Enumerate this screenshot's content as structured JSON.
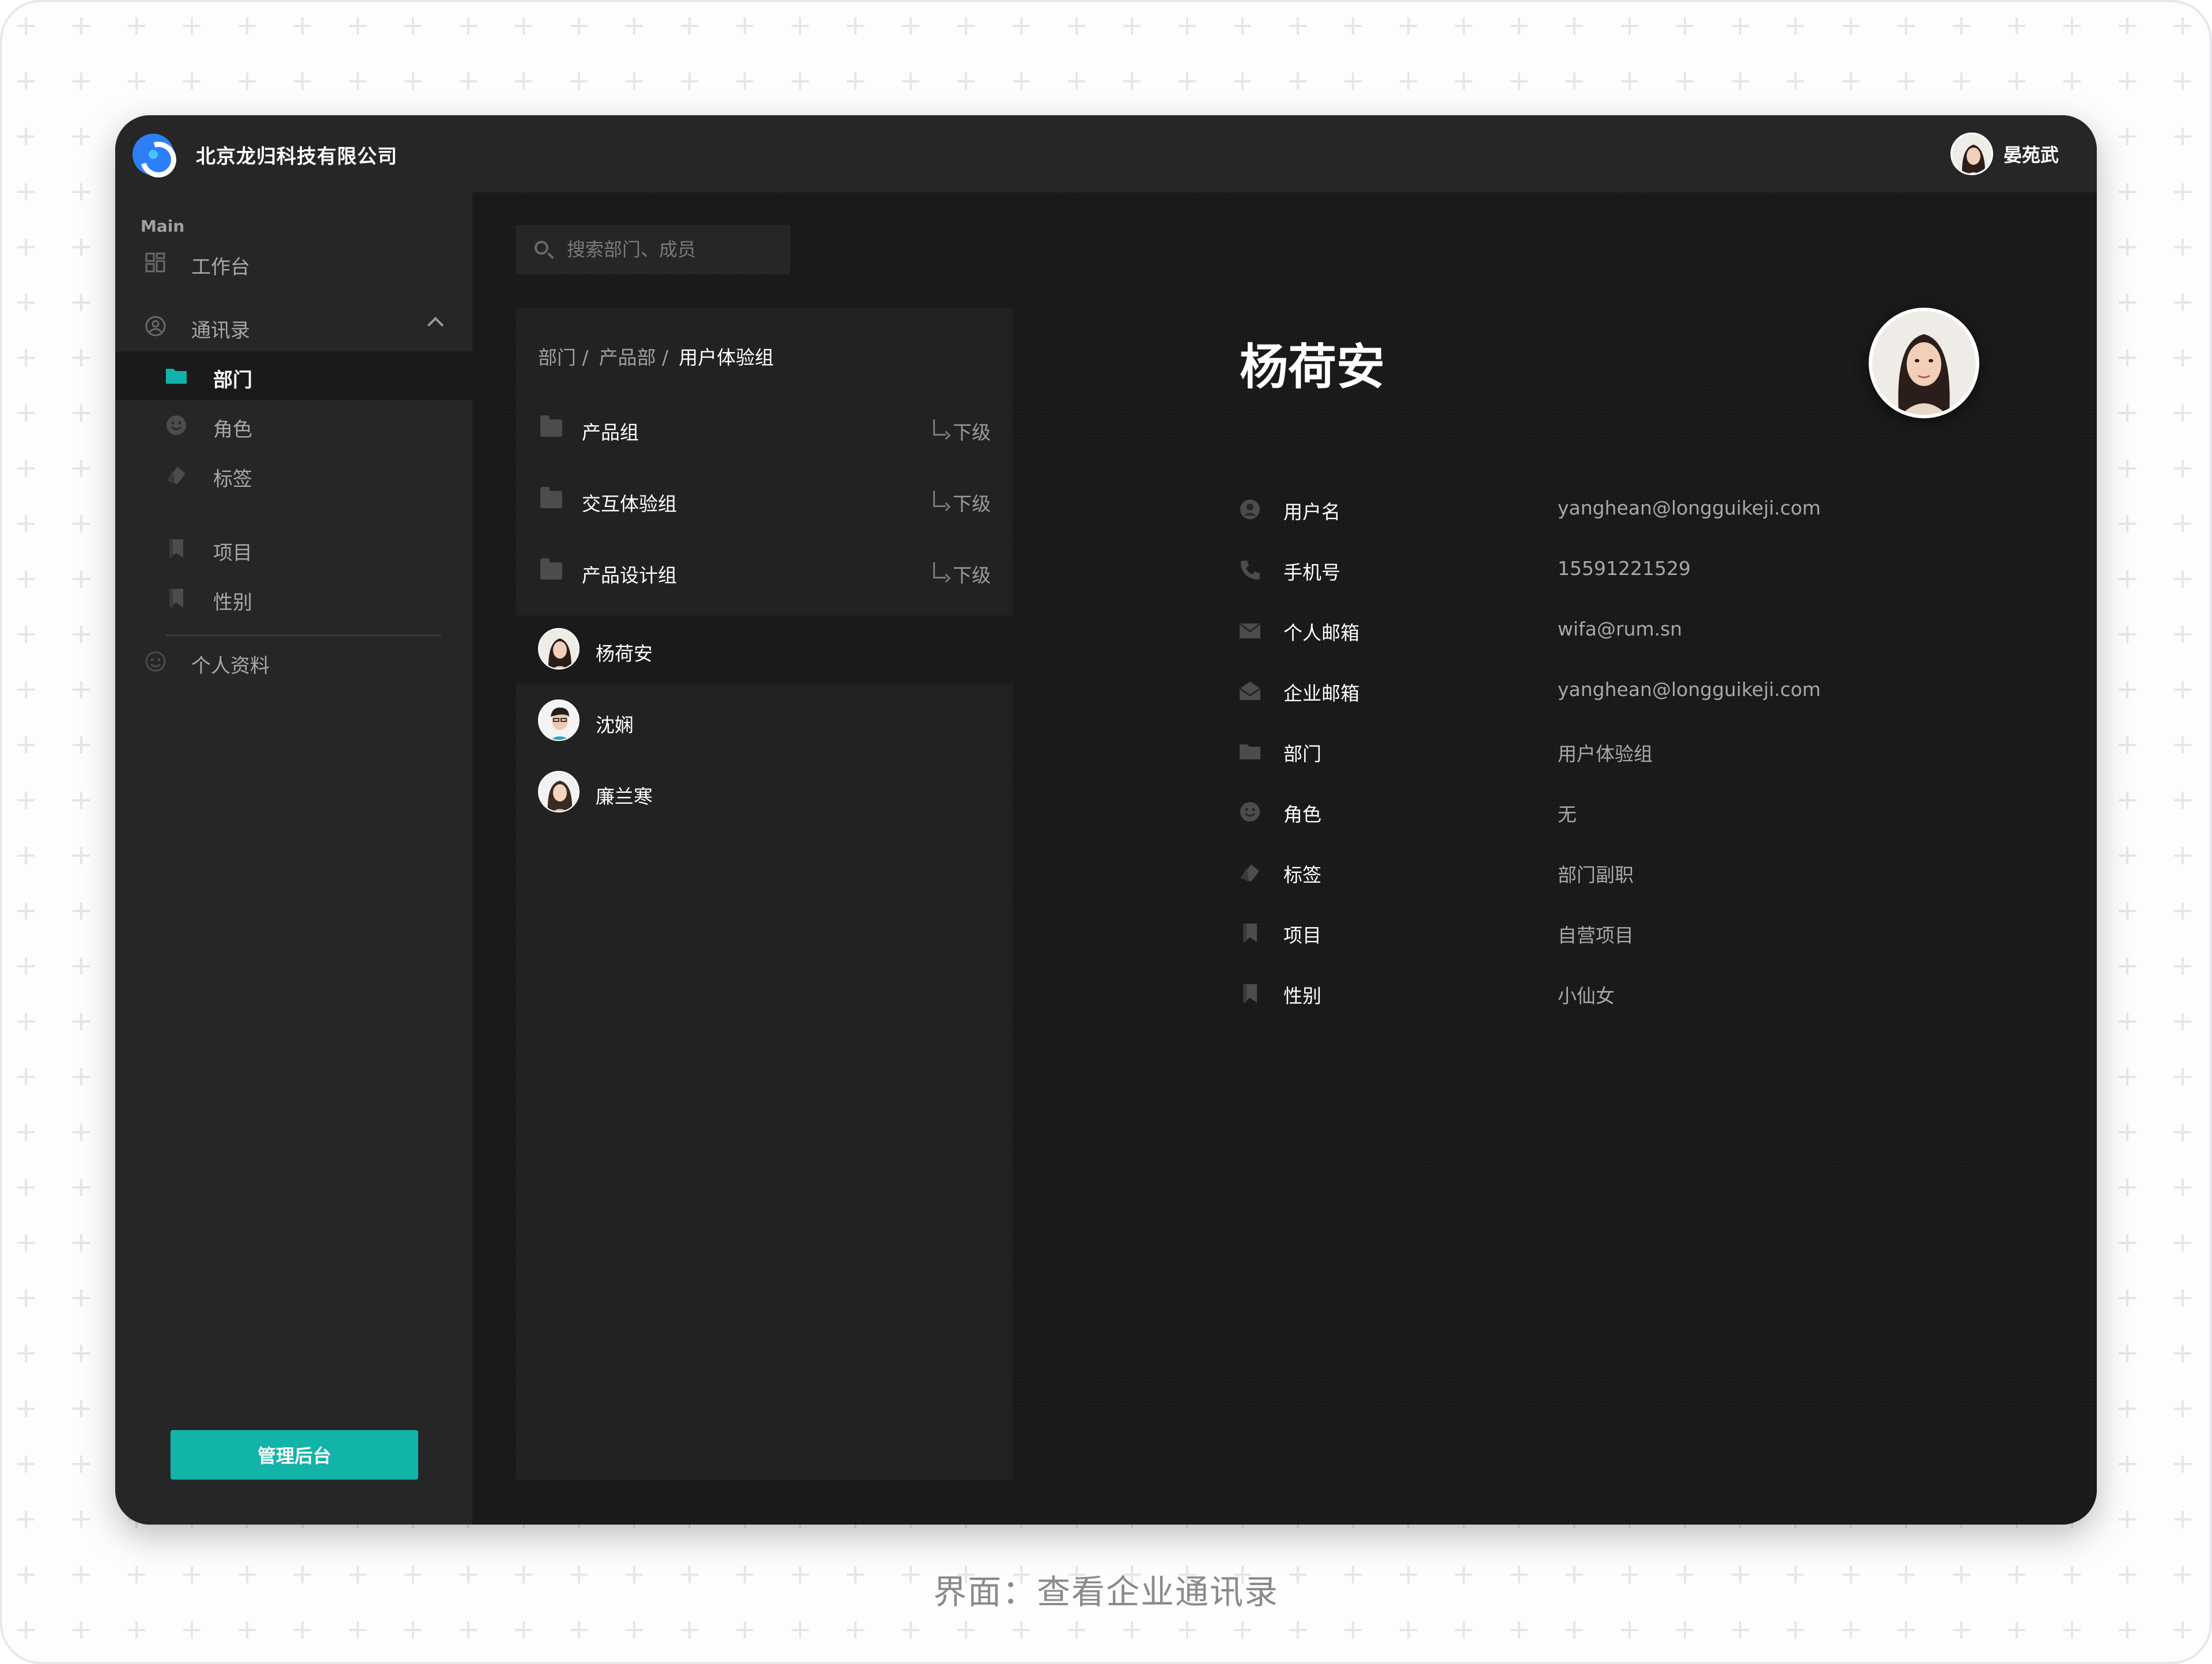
{
  "header": {
    "company": "北京龙归科技有限公司",
    "user_name": "晏苑武"
  },
  "sidebar": {
    "section": "Main",
    "items": [
      {
        "label": "工作台",
        "icon": "dashboard-icon"
      },
      {
        "label": "通讯录",
        "icon": "contacts-icon"
      },
      {
        "label": "部门",
        "icon": "folder-icon"
      },
      {
        "label": "角色",
        "icon": "smiley-icon"
      },
      {
        "label": "标签",
        "icon": "tag-icon"
      },
      {
        "label": "项目",
        "icon": "bookmark-icon"
      },
      {
        "label": "性别",
        "icon": "bookmark-icon"
      },
      {
        "label": "个人资料",
        "icon": "profile-icon"
      }
    ],
    "admin_button": "管理后台"
  },
  "search": {
    "placeholder": "搜索部门、成员"
  },
  "tree": {
    "breadcrumb": [
      "部门 /",
      "产品部 /",
      "用户体验组"
    ],
    "sub_label": "下级",
    "folders": [
      "产品组",
      "交互体验组",
      "产品设计组"
    ],
    "members": [
      "杨荷安",
      "沈娴",
      "廉兰寒"
    ]
  },
  "detail": {
    "name": "杨荷安",
    "fields": [
      {
        "key": "用户名",
        "value": "yanghean@longguikeji.com",
        "icon": "user-circle-icon"
      },
      {
        "key": "手机号",
        "value": "15591221529",
        "icon": "phone-icon"
      },
      {
        "key": "个人邮箱",
        "value": "wifa@rum.sn",
        "icon": "mail-icon"
      },
      {
        "key": "企业邮箱",
        "value": "yanghean@longguikeji.com",
        "icon": "mail-open-icon"
      },
      {
        "key": "部门",
        "value": "用户体验组",
        "icon": "folder-icon"
      },
      {
        "key": "角色",
        "value": "无",
        "icon": "smiley-icon"
      },
      {
        "key": "标签",
        "value": "部门副职",
        "icon": "tag-icon"
      },
      {
        "key": "项目",
        "value": "自营项目",
        "icon": "bookmark-icon"
      },
      {
        "key": "性别",
        "value": "小仙女",
        "icon": "bookmark-icon"
      }
    ]
  },
  "caption": "界面：查看企业通讯录",
  "colors": {
    "accent": "#12b3a8",
    "brand": "#2d7ff9",
    "background_dark": "#1a1a1a",
    "panel": "#262626"
  }
}
